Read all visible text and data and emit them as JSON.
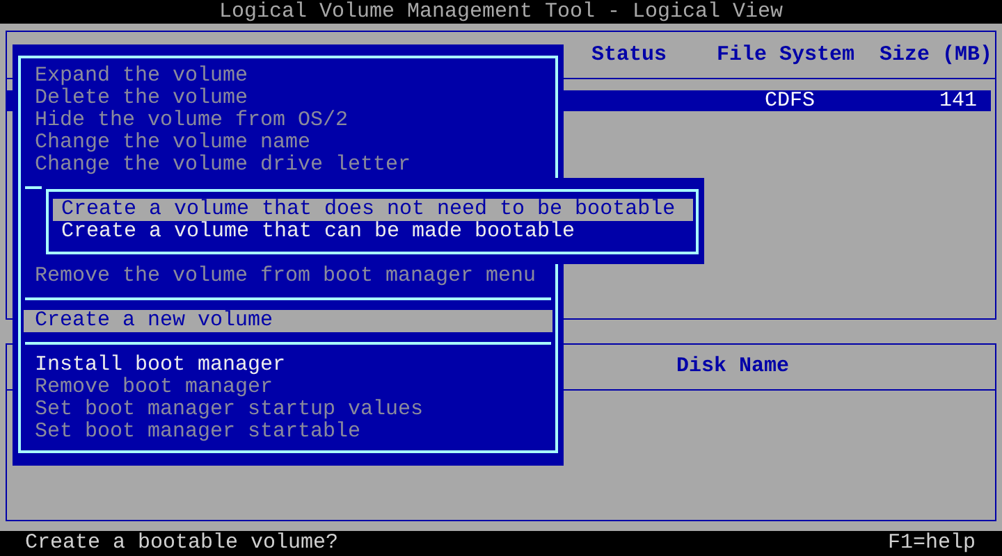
{
  "window": {
    "title": "Logical Volume Management Tool - Logical View"
  },
  "volume_table": {
    "columns": [
      "Status",
      "File System",
      "Size (MB)"
    ],
    "rows": [
      {
        "file_system": "CDFS",
        "size": "141",
        "selected": true
      }
    ]
  },
  "disk_table": {
    "columns": [
      "Disk Name"
    ]
  },
  "menu": {
    "items": [
      {
        "kind": "item",
        "label": "Expand the volume",
        "disabled": true,
        "selected": false
      },
      {
        "kind": "item",
        "label": "Delete the volume",
        "disabled": true,
        "selected": false
      },
      {
        "kind": "item",
        "label": "Hide the volume from OS/2",
        "disabled": true,
        "selected": false
      },
      {
        "kind": "item",
        "label": "Change the volume name",
        "disabled": true,
        "selected": false
      },
      {
        "kind": "item",
        "label": "Change the volume drive letter",
        "disabled": true,
        "selected": false
      },
      {
        "kind": "separator"
      },
      {
        "kind": "submenu",
        "items": [
          {
            "label": "Create a volume that does not need to be bootable",
            "disabled": false,
            "selected": true
          },
          {
            "label": "Create a volume that can be made bootable",
            "disabled": false,
            "selected": false
          }
        ]
      },
      {
        "kind": "item",
        "label": "Remove the volume from boot manager menu",
        "disabled": true,
        "selected": false
      },
      {
        "kind": "separator"
      },
      {
        "kind": "item",
        "label": "Create a new volume",
        "disabled": false,
        "selected": true
      },
      {
        "kind": "separator"
      },
      {
        "kind": "item",
        "label": "Install boot manager",
        "disabled": false,
        "selected": false
      },
      {
        "kind": "item",
        "label": "Remove boot manager",
        "disabled": true,
        "selected": false
      },
      {
        "kind": "item",
        "label": "Set boot manager startup values",
        "disabled": true,
        "selected": false
      },
      {
        "kind": "item",
        "label": "Set boot manager startable",
        "disabled": true,
        "selected": false
      }
    ]
  },
  "status_bar": {
    "message": "Create a bootable volume?",
    "help": "F1=help"
  }
}
